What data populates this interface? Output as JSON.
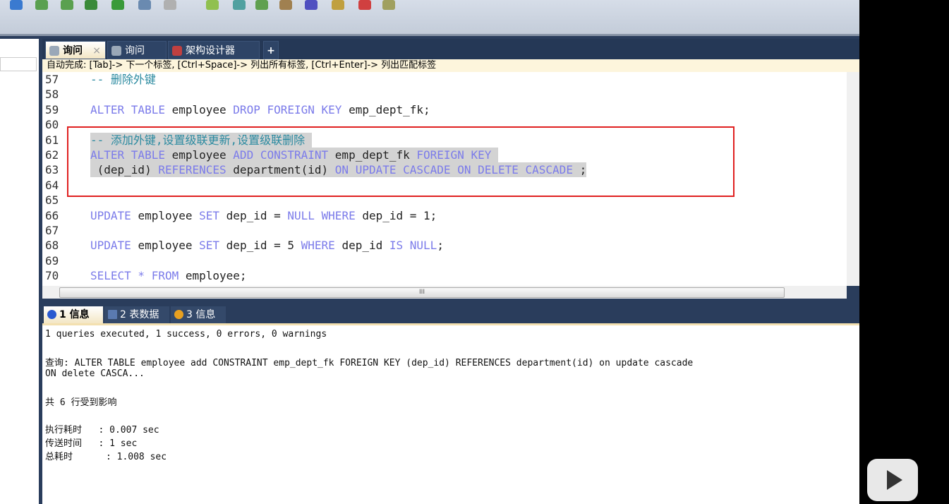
{
  "tabs": [
    {
      "label": "询问",
      "active": true
    },
    {
      "label": "询问"
    },
    {
      "label": "架构设计器"
    }
  ],
  "add_tab": "+",
  "close_tab": "×",
  "hint": "自动完成: [Tab]-> 下一个标签, [Ctrl+Space]-> 列出所有标签, [Ctrl+Enter]-> 列出匹配标签",
  "code_lines": [
    {
      "n": "57",
      "t": [
        [
          "cm",
          "-- 删除外键"
        ]
      ]
    },
    {
      "n": "58",
      "t": []
    },
    {
      "n": "59",
      "t": [
        [
          "kw",
          "ALTER TABLE "
        ],
        [
          "id",
          "employee "
        ],
        [
          "kw",
          "DROP FOREIGN KEY "
        ],
        [
          "id",
          "emp_dept_fk;"
        ]
      ]
    },
    {
      "n": "60",
      "t": []
    },
    {
      "n": "61",
      "t": [
        [
          "cm",
          "-- 添加外键,设置级联更新,设置级联删除 "
        ]
      ],
      "sel": true
    },
    {
      "n": "62",
      "t": [
        [
          "kw",
          "ALTER TABLE "
        ],
        [
          "id",
          "employee "
        ],
        [
          "kw",
          "ADD CONSTRAINT "
        ],
        [
          "id",
          "emp_dept_fk "
        ],
        [
          "kw",
          "FOREIGN KEY "
        ]
      ],
      "sel": true
    },
    {
      "n": "63",
      "t": [
        [
          "id",
          " (dep_id) "
        ],
        [
          "kw",
          "REFERENCES "
        ],
        [
          "id",
          "department(id) "
        ],
        [
          "kw",
          "ON UPDATE CASCADE ON DELETE CASCADE "
        ],
        [
          "id",
          ";"
        ]
      ],
      "sel": true
    },
    {
      "n": "64",
      "t": []
    },
    {
      "n": "65",
      "t": []
    },
    {
      "n": "66",
      "t": [
        [
          "kw",
          "UPDATE "
        ],
        [
          "id",
          "employee "
        ],
        [
          "kw",
          "SET "
        ],
        [
          "id",
          "dep_id = "
        ],
        [
          "kw",
          "NULL WHERE "
        ],
        [
          "id",
          "dep_id = 1;"
        ]
      ]
    },
    {
      "n": "67",
      "t": []
    },
    {
      "n": "68",
      "t": [
        [
          "kw",
          "UPDATE "
        ],
        [
          "id",
          "employee "
        ],
        [
          "kw",
          "SET "
        ],
        [
          "id",
          "dep_id = 5 "
        ],
        [
          "kw",
          "WHERE "
        ],
        [
          "id",
          "dep_id "
        ],
        [
          "kw",
          "IS NULL"
        ],
        [
          "id",
          ";"
        ]
      ]
    },
    {
      "n": "69",
      "t": []
    },
    {
      "n": "70",
      "t": [
        [
          "kw",
          "SELECT * FROM "
        ],
        [
          "id",
          "employee;"
        ]
      ]
    }
  ],
  "result_tabs": [
    {
      "label": "1 信息",
      "color": "#2a5ad0"
    },
    {
      "label": "2 表数据",
      "color": "#5a7ab0"
    },
    {
      "label": "3 信息",
      "color": "#e8a020"
    }
  ],
  "results": [
    "1 queries executed, 1 success, 0 errors, 0 warnings",
    "",
    "查询: ALTER TABLE employee add CONSTRAINT emp_dept_fk FOREIGN KEY (dep_id) REFERENCES department(id) on update cascade",
    "ON delete CASCA...",
    "",
    "共 6 行受到影响",
    "",
    "执行耗时   : 0.007 sec",
    "传送时间   : 1 sec",
    "总耗时      : 1.008 sec"
  ],
  "hscroll_grip": "III"
}
